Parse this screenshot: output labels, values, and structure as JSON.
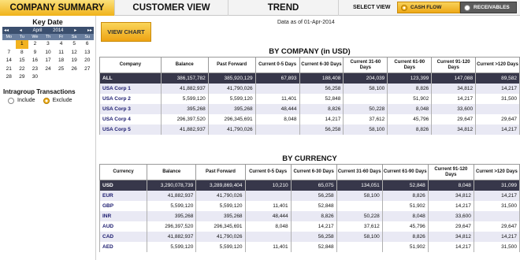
{
  "tabs": [
    {
      "label": "COMPANY SUMMARY",
      "active": true
    },
    {
      "label": "CUSTOMER VIEW",
      "active": false
    },
    {
      "label": "TREND",
      "active": false
    }
  ],
  "select_view": {
    "label": "SELECT VIEW",
    "options": [
      {
        "label": "CASH FLOW",
        "selected": true
      },
      {
        "label": "RECEIVABLES",
        "selected": false
      }
    ]
  },
  "key_date": {
    "title": "Key Date",
    "month": "April",
    "year": "2014",
    "weekdays": [
      "Mo",
      "Tu",
      "We",
      "Th",
      "Fr",
      "Sa",
      "Su"
    ],
    "weeks": [
      [
        "",
        "1",
        "2",
        "3",
        "4",
        "5",
        "6"
      ],
      [
        "7",
        "8",
        "9",
        "10",
        "11",
        "12",
        "13"
      ],
      [
        "14",
        "15",
        "16",
        "17",
        "18",
        "19",
        "20"
      ],
      [
        "21",
        "22",
        "23",
        "24",
        "25",
        "26",
        "27"
      ],
      [
        "28",
        "29",
        "30",
        "",
        "",
        "",
        ""
      ]
    ],
    "selected_day": "1",
    "nav_prev_year": "◂◂",
    "nav_prev_month": "◂",
    "nav_next_month": "▸",
    "nav_next_year": "▸▸"
  },
  "intragroup": {
    "title": "Intragroup Transactions",
    "options": [
      {
        "label": "Include",
        "selected": false
      },
      {
        "label": "Exclude",
        "selected": true
      }
    ]
  },
  "view_chart_label": "VIEW CHART",
  "as_of": "Data as of 01-Apr-2014",
  "by_company": {
    "title": "BY COMPANY (in USD)",
    "headers": [
      "Company",
      "Balance",
      "Past Forward",
      "Current 0-5 Days",
      "Current 6-30 Days",
      "Current 31-60 Days",
      "Current 61-90 Days",
      "Current 91-120 Days",
      "Current >120 Days"
    ],
    "rows": [
      [
        "ALL",
        "386,157,782",
        "385,920,129",
        "67,893",
        "188,408",
        "204,039",
        "123,399",
        "147,088",
        "89,582"
      ],
      [
        "USA Corp 1",
        "41,882,937",
        "41,790,026",
        "",
        "56,258",
        "58,100",
        "8,826",
        "34,812",
        "14,217"
      ],
      [
        "USA Corp 2",
        "5,599,120",
        "5,599,120",
        "11,401",
        "52,848",
        "",
        "51,902",
        "14,217",
        "31,500"
      ],
      [
        "USA Corp 3",
        "395,268",
        "395,268",
        "48,444",
        "8,826",
        "50,228",
        "8,048",
        "33,600",
        ""
      ],
      [
        "USA Corp 4",
        "296,397,520",
        "296,345,691",
        "8,048",
        "14,217",
        "37,612",
        "45,796",
        "29,647",
        "29,647"
      ],
      [
        "USA Corp 5",
        "41,882,937",
        "41,790,026",
        "",
        "56,258",
        "58,100",
        "8,826",
        "34,812",
        "14,217"
      ]
    ]
  },
  "by_currency": {
    "title": "BY CURRENCY",
    "headers": [
      "Currency",
      "Balance",
      "Past Forward",
      "Current 0-5 Days",
      "Current 6-30 Days",
      "Current 31-60 Days",
      "Current 61-90 Days",
      "Current 91-120 Days",
      "Current >120 Days"
    ],
    "rows": [
      [
        "USD",
        "3,290,078,739",
        "3,289,869,404",
        "10,210",
        "65,075",
        "134,051",
        "52,848",
        "8,048",
        "31,099"
      ],
      [
        "EUR",
        "41,882,937",
        "41,790,026",
        "",
        "56,258",
        "58,100",
        "8,826",
        "34,812",
        "14,217"
      ],
      [
        "GBP",
        "5,599,120",
        "5,599,120",
        "11,401",
        "52,848",
        "",
        "51,902",
        "14,217",
        "31,500"
      ],
      [
        "INR",
        "395,268",
        "395,268",
        "48,444",
        "8,826",
        "50,228",
        "8,048",
        "33,600",
        ""
      ],
      [
        "AUD",
        "296,397,520",
        "296,345,691",
        "8,048",
        "14,217",
        "37,612",
        "45,796",
        "29,647",
        "29,647"
      ],
      [
        "CAD",
        "41,882,937",
        "41,790,026",
        "",
        "56,258",
        "58,100",
        "8,826",
        "34,812",
        "14,217"
      ],
      [
        "AED",
        "5,599,120",
        "5,599,120",
        "11,401",
        "52,848",
        "",
        "51,902",
        "14,217",
        "31,500"
      ]
    ]
  },
  "colors": {
    "accent": "#f0b21a",
    "dark_row": "#37374a",
    "alt_row": "#e9e9f4",
    "link_text": "#1a1a6e"
  }
}
